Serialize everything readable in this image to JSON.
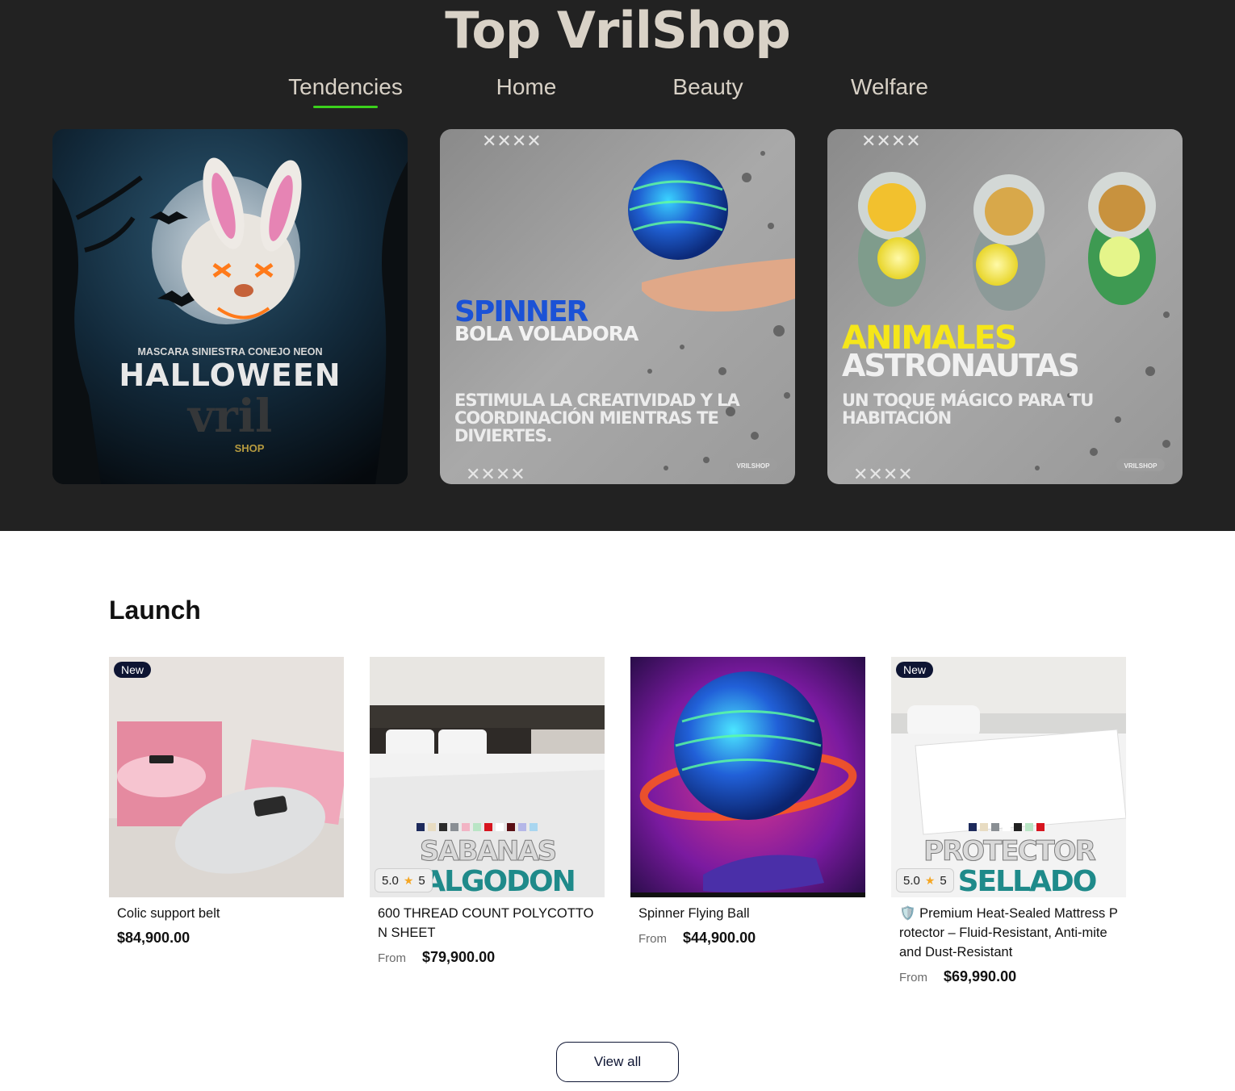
{
  "site": {
    "title": "Top VrilShop"
  },
  "tabs": [
    {
      "label": "Tendencies",
      "active": true
    },
    {
      "label": "Home",
      "active": false
    },
    {
      "label": "Beauty",
      "active": false
    },
    {
      "label": "Welfare",
      "active": false
    }
  ],
  "accent_color": "#3bd11c",
  "banners": [
    {
      "line1": "MASCARA SINIESTRA CONEJO NEON",
      "line2": "HALLOWEEN",
      "brand": "vril",
      "brand_sub": "SHOP"
    },
    {
      "headline": "SPINNER",
      "subhead": "BOLA VOLADORA",
      "body": [
        "ESTIMULA LA CREATIVIDAD Y LA",
        "COORDINACIÓN MIENTRAS TE",
        "DIVIERTES."
      ],
      "tag": "VRILSHOP"
    },
    {
      "headline": "ANIMALES",
      "subhead": "ASTRONAUTAS",
      "body": [
        "UN TOQUE MÁGICO PARA TU",
        "HABITACIÓN"
      ],
      "tag": "VRILSHOP"
    }
  ],
  "launch": {
    "title": "Launch",
    "products": [
      {
        "badge": "New",
        "title": "Colic support belt",
        "from": "",
        "price": "$84,900.00"
      },
      {
        "badge": "",
        "title": "600 THREAD COUNT POLYCOTTON SHEET",
        "from": "From",
        "price": "$79,900.00",
        "rating": {
          "score": "5.0",
          "count": "5"
        },
        "image_text": "SABANAS ALGODON"
      },
      {
        "badge": "",
        "title": "Spinner Flying Ball",
        "from": "From",
        "price": "$44,900.00"
      },
      {
        "badge": "New",
        "title": "🛡️ Premium Heat-Sealed Mattress Protector – Fluid-Resistant, Anti-mite and Dust-Resistant",
        "from": "From",
        "price": "$69,990.00",
        "rating": {
          "score": "5.0",
          "count": "5"
        },
        "image_text": "PROTECTOR SELLADO"
      }
    ],
    "view_all": "View all"
  }
}
